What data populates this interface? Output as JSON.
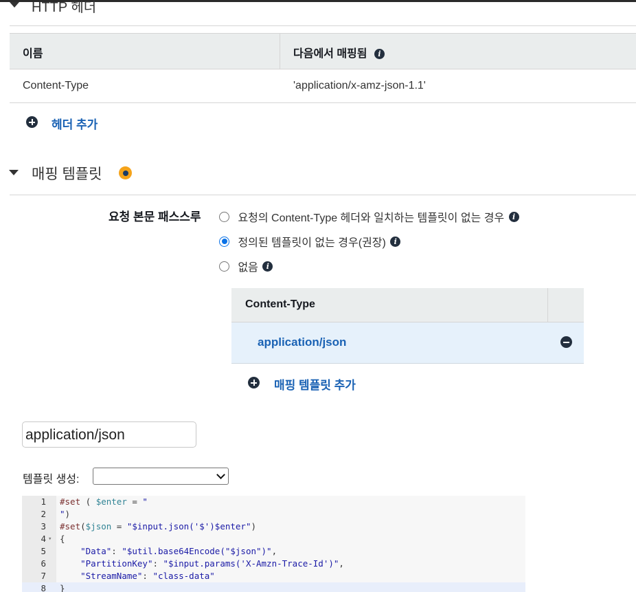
{
  "http_header_section": {
    "title": "HTTP 헤더",
    "table": {
      "col_name": "이름",
      "col_mapped_from": "다음에서 매핑됨",
      "rows": [
        {
          "name": "Content-Type",
          "mapped_from": "'application/x-amz-json-1.1'"
        }
      ]
    },
    "add_header_label": "헤더 추가"
  },
  "mapping_template_section": {
    "title": "매핑 템플릿",
    "passthrough_label": "요청 본문 패스스루",
    "options": [
      {
        "label": "요청의 Content-Type 헤더와 일치하는 템플릿이 없는 경우",
        "selected": false
      },
      {
        "label": "정의된 템플릿이 없는 경우(권장)",
        "selected": true
      },
      {
        "label": "없음",
        "selected": false
      }
    ],
    "content_type_table": {
      "header": "Content-Type",
      "rows": [
        {
          "value": "application/json"
        }
      ]
    },
    "add_mapping_template_label": "매핑 템플릿 추가",
    "content_type_input_value": "application/json",
    "generate_template_label": "템플릿 생성:",
    "generate_template_selected": ""
  },
  "editor": {
    "lines": [
      {
        "n": "1",
        "text": "#set ( $enter = \""
      },
      {
        "n": "2",
        "text": "\")"
      },
      {
        "n": "3",
        "text": "#set($json = \"$input.json('$')$enter\")"
      },
      {
        "n": "4",
        "text": "{"
      },
      {
        "n": "5",
        "text": "    \"Data\": \"$util.base64Encode(\"$json\")\","
      },
      {
        "n": "6",
        "text": "    \"PartitionKey\": \"$input.params('X-Amzn-Trace-Id')\","
      },
      {
        "n": "7",
        "text": "    \"StreamName\": \"class-data\""
      },
      {
        "n": "8",
        "text": "}"
      }
    ]
  },
  "colors": {
    "link": "#1a62b4",
    "accent_orange": "#f5a31a",
    "radio_selected": "#0b72e7"
  }
}
